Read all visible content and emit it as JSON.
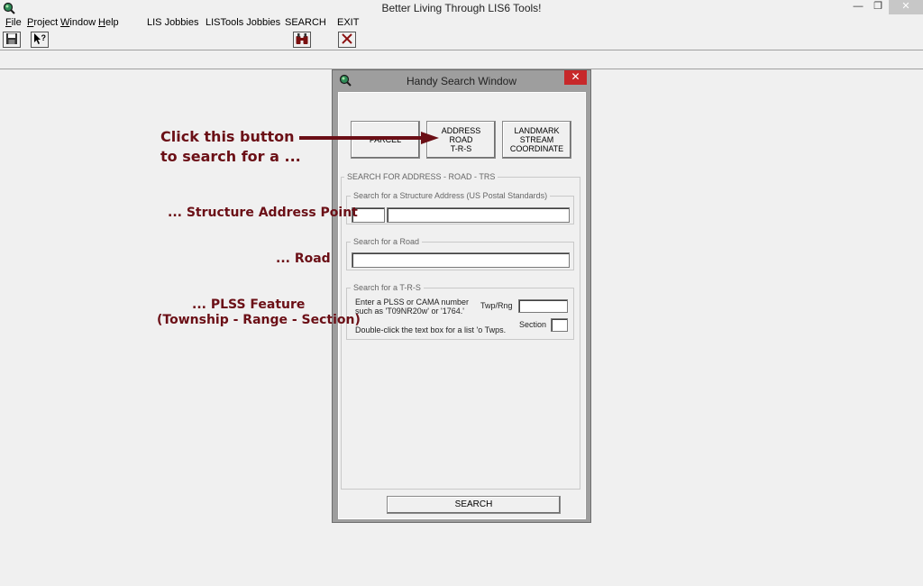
{
  "app": {
    "title": "Better Living Through LIS6 Tools!",
    "win_min": "—",
    "win_max": "❐",
    "win_close": "✕"
  },
  "menu": {
    "file_first": "F",
    "file_rest": "ile",
    "project_first": "P",
    "project_rest": "roject",
    "window_first": "W",
    "window_rest": "indow",
    "help_first": "H",
    "help_rest": "elp",
    "lis_jobbies": "LIS  Jobbies",
    "listools_jobbies": "LISTools Jobbies",
    "search": "SEARCH",
    "exit": "EXIT"
  },
  "dialog": {
    "title": "Handy Search Window",
    "close": "✕",
    "btn_parcel": "PARCEL",
    "btn_address": [
      "ADDRESS",
      "ROAD",
      "T-R-S"
    ],
    "btn_landmark": [
      "LANDMARK",
      "STREAM",
      "COORDINATE"
    ],
    "search_group_label": "SEARCH FOR  ADDRESS  - ROAD  - TRS",
    "structure_group_label": "Search for a  Structure Address (US Postal Standards)",
    "road_group_label": "Search for a Road",
    "trs_group_label": "Search for a T-R-S",
    "trs_hint_line1": "Enter a PLSS or CAMA number",
    "trs_hint_line2": "such as 'T09NR20w' or '1764.'",
    "twp_rng_label": "Twp/Rng",
    "section_label": "Section",
    "twps_hint": "Double-click the text box for a list 'o Twps.",
    "search_button": "SEARCH",
    "fields": {
      "house_number": "",
      "street": "",
      "road": "",
      "twp_rng": "",
      "section": ""
    }
  },
  "annotations": {
    "click_line1": "Click this button",
    "click_line2": "to search for a ...",
    "structure": "... Structure Address Point",
    "road": "... Road",
    "plss_line1": "... PLSS Feature",
    "plss_line2": "(Township - Range - Section)"
  },
  "colors": {
    "annotation": "#6b0f16",
    "dialog_frame": "#9e9e9e",
    "close_red": "#c7282a"
  }
}
